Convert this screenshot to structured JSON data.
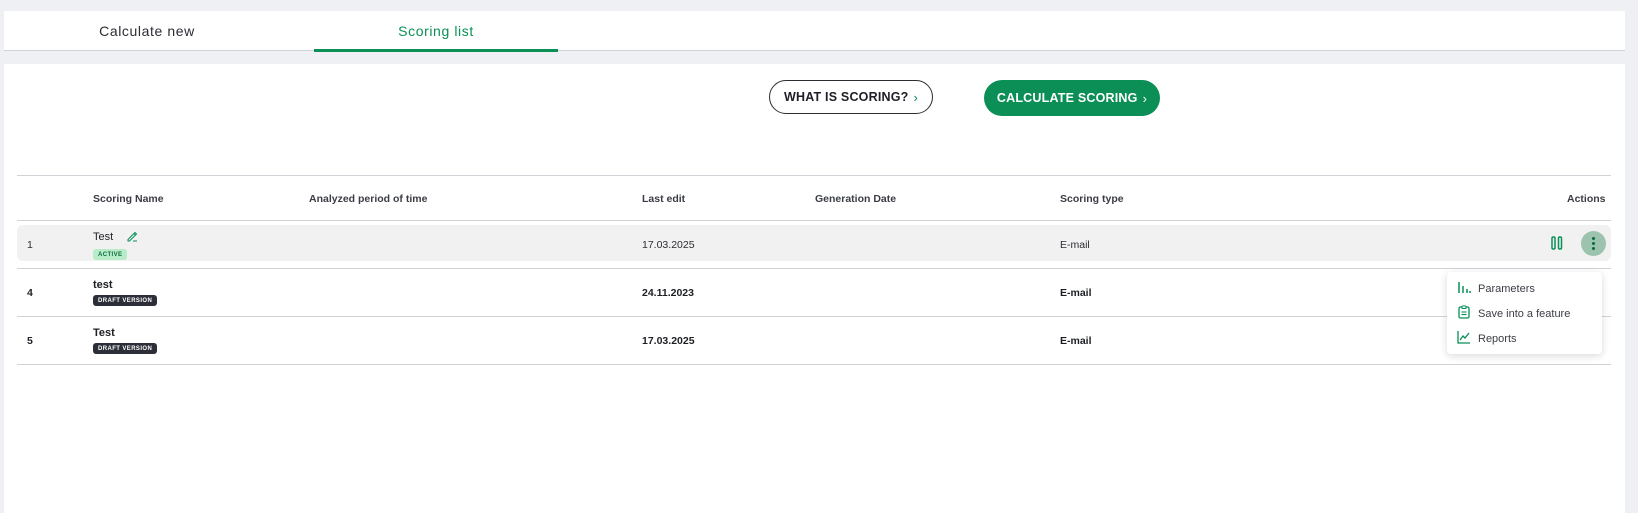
{
  "tabs": {
    "calculate_new": "Calculate new",
    "scoring_list": "Scoring list"
  },
  "buttons": {
    "what_is_scoring": "WHAT IS SCORING?",
    "calculate_scoring": "CALCULATE SCORING"
  },
  "table": {
    "headers": {
      "name": "Scoring Name",
      "period": "Analyzed period of time",
      "last_edit": "Last edit",
      "generation": "Generation Date",
      "type": "Scoring type",
      "actions": "Actions"
    },
    "rows": [
      {
        "id": "1",
        "name": "Test",
        "badge": "ACTIVE",
        "last_edit": "17.03.2025",
        "type": "E-mail"
      },
      {
        "id": "4",
        "name": "test",
        "badge": "DRAFT VERSION",
        "last_edit": "24.11.2023",
        "type": "E-mail"
      },
      {
        "id": "5",
        "name": "Test",
        "badge": "DRAFT VERSION",
        "last_edit": "17.03.2025",
        "type": "E-mail"
      }
    ]
  },
  "menu": {
    "parameters": "Parameters",
    "save_feature": "Save into a feature",
    "reports": "Reports"
  },
  "colors": {
    "accent": "#0b8f57",
    "active_badge_bg": "#b8ecc9",
    "draft_badge_bg": "#2c2f38"
  }
}
